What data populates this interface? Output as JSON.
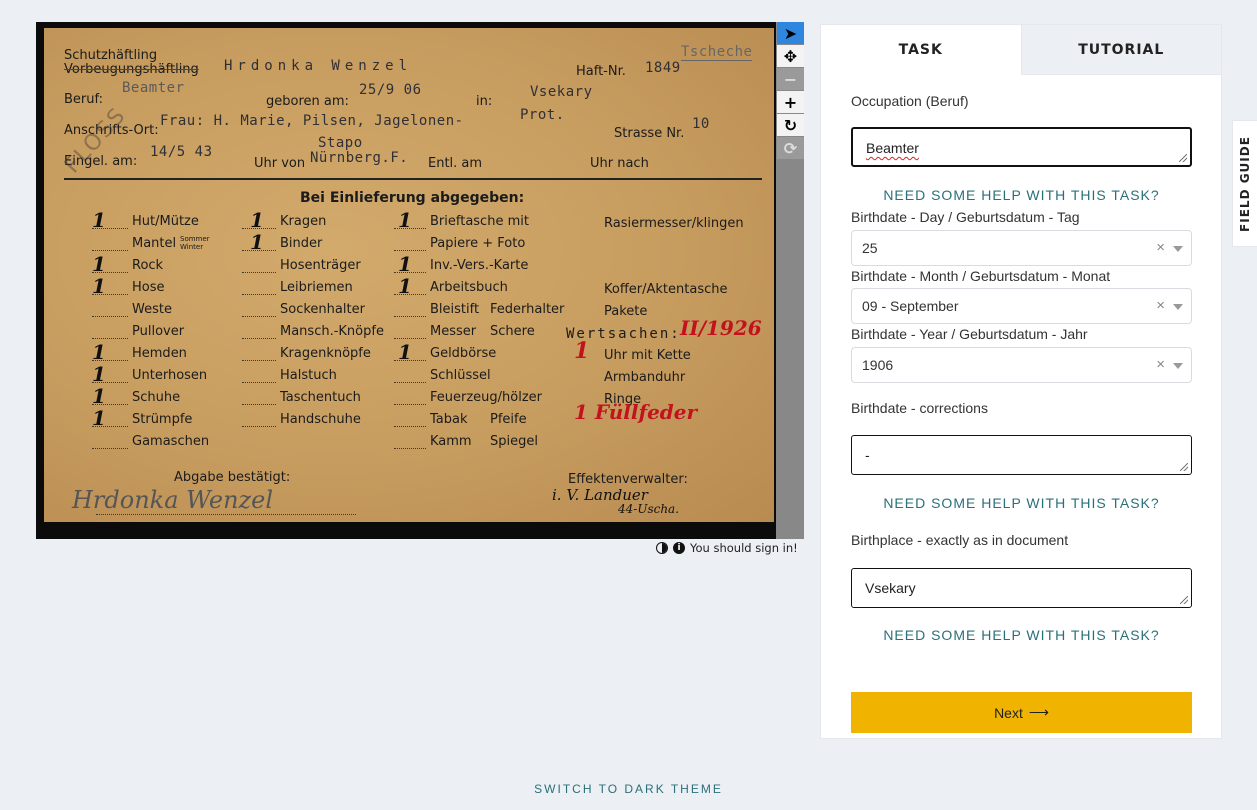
{
  "toolbar": {
    "tools": [
      {
        "name": "pointer",
        "glyph": "➤"
      },
      {
        "name": "move",
        "glyph": "✥"
      },
      {
        "name": "zoom-out",
        "glyph": "−"
      },
      {
        "name": "zoom-in",
        "glyph": "+"
      },
      {
        "name": "rotate",
        "glyph": "↻"
      },
      {
        "name": "reset",
        "glyph": "⟳"
      }
    ]
  },
  "viewer_footer": {
    "sign_in_text": "You should sign in!"
  },
  "document": {
    "header": {
      "schutzhaeftling": "Schutzhäftling",
      "vorbeugungshaeftling": "Vorbeugungshäftling",
      "name": "Hrdonka Wenzel",
      "haft_nr_label": "Haft-Nr.",
      "haft_nr": "1849",
      "nationality": "Tscheche",
      "beruf_label": "Beruf:",
      "beruf": "Beamter",
      "geboren_label": "geboren am:",
      "geboren": "25/9 06",
      "in_label": "in:",
      "birthplace": "Vsekary",
      "anschrift_label": "Anschrifts-Ort:",
      "anschrift": "Frau: H. Marie, Pilsen, Jagelonen-",
      "religion": "Prot.",
      "strasse_label": "Strasse Nr.",
      "strasse_nr": "10",
      "eingel_label": "Eingel. am:",
      "eingel_date": "14/5 43",
      "uhr_von_label": "Uhr von",
      "stapo": "Stapo",
      "stapo_city": "Nürnberg.F.",
      "entl_label": "Entl. am",
      "uhr_nach_label": "Uhr nach",
      "stamp": "FLOSS"
    },
    "section_title": "Bei Einlieferung abgegeben:",
    "col1": [
      {
        "label": "Hut/Mütze",
        "mark": "1"
      },
      {
        "label": "Mantel",
        "mark": "",
        "note": "Sommer Winter"
      },
      {
        "label": "Rock",
        "mark": "1"
      },
      {
        "label": "Hose",
        "mark": "1"
      },
      {
        "label": "Weste",
        "mark": ""
      },
      {
        "label": "Pullover",
        "mark": ""
      },
      {
        "label": "Hemden",
        "mark": "1"
      },
      {
        "label": "Unterhosen",
        "mark": "1"
      },
      {
        "label": "Schuhe",
        "mark": "1"
      },
      {
        "label": "Strümpfe",
        "mark": "1"
      },
      {
        "label": "Gamaschen",
        "mark": ""
      }
    ],
    "col2": [
      {
        "label": "Kragen",
        "mark": "1"
      },
      {
        "label": "Binder",
        "mark": "1"
      },
      {
        "label": "Hosenträger",
        "mark": ""
      },
      {
        "label": "Leibriemen",
        "mark": ""
      },
      {
        "label": "Sockenhalter",
        "mark": ""
      },
      {
        "label": "Mansch.-Knöpfe",
        "mark": ""
      },
      {
        "label": "Kragenknöpfe",
        "mark": ""
      },
      {
        "label": "Halstuch",
        "mark": ""
      },
      {
        "label": "Taschentuch",
        "mark": ""
      },
      {
        "label": "Handschuhe",
        "mark": ""
      }
    ],
    "col3": [
      {
        "label": "Brieftasche mit",
        "mark": "1"
      },
      {
        "label": "Papiere + Foto",
        "mark": ""
      },
      {
        "label": "Inv.-Vers.-Karte",
        "mark": "1"
      },
      {
        "label": "Arbeitsbuch",
        "mark": "1"
      },
      {
        "label": "Bleistift",
        "label2": "Federhalter",
        "mark": ""
      },
      {
        "label": "Messer",
        "label2": "Schere",
        "mark": ""
      },
      {
        "label": "Geldbörse",
        "mark": "1"
      },
      {
        "label": "Schlüssel",
        "mark": ""
      },
      {
        "label": "Feuerzeug/hölzer",
        "mark": ""
      },
      {
        "label": "Tabak",
        "label2": "Pfeife",
        "mark": ""
      },
      {
        "label": "Kamm",
        "label2": "Spiegel",
        "mark": ""
      }
    ],
    "col4": {
      "rasiermesser": "Rasiermesser/klingen",
      "koffer": "Koffer/Aktentasche",
      "pakete": "Pakete",
      "wertsachen_label": "Wertsachen:",
      "wertsachen_no": "II/1926",
      "uhr_mit_kette": "Uhr mit Kette",
      "uhr_mark": "1",
      "armbanduhr": "Armbanduhr",
      "ringe": "Ringe",
      "fuellfeder": "1 Füllfeder"
    },
    "footer": {
      "abgabe_label": "Abgabe bestätigt:",
      "signature": "Hrdonka Wenzel",
      "effekten_label": "Effektenverwalter:",
      "effekten_sig": "i. V. Landuer",
      "effekten_sig2": "44-Uscha."
    }
  },
  "panel": {
    "tabs": [
      {
        "label": "TASK",
        "active": true
      },
      {
        "label": "TUTORIAL",
        "active": false
      }
    ],
    "occupation_label": "Occupation (Beruf)",
    "occupation_value": "Beamter",
    "help_text": "NEED SOME HELP WITH THIS TASK?",
    "birth_day_label": "Birthdate - Day / Geburtsdatum - Tag",
    "birth_day_value": "25",
    "birth_month_label": "Birthdate - Month / Geburtsdatum - Monat",
    "birth_month_value": "09 - September",
    "birth_year_label": "Birthdate - Year / Geburtsdatum - Jahr",
    "birth_year_value": "1906",
    "corrections_label": "Birthdate - corrections",
    "corrections_value": "-",
    "birthplace_label": "Birthplace - exactly as in document",
    "birthplace_value": "Vsekary",
    "next_label": "Next",
    "next_arrow": "⟶"
  },
  "field_guide": "FIELD GUIDE",
  "theme_switch": "SWITCH TO DARK THEME",
  "colors": {
    "accent": "#2a7079",
    "button": "#f0b400",
    "background": "#eceff4"
  }
}
